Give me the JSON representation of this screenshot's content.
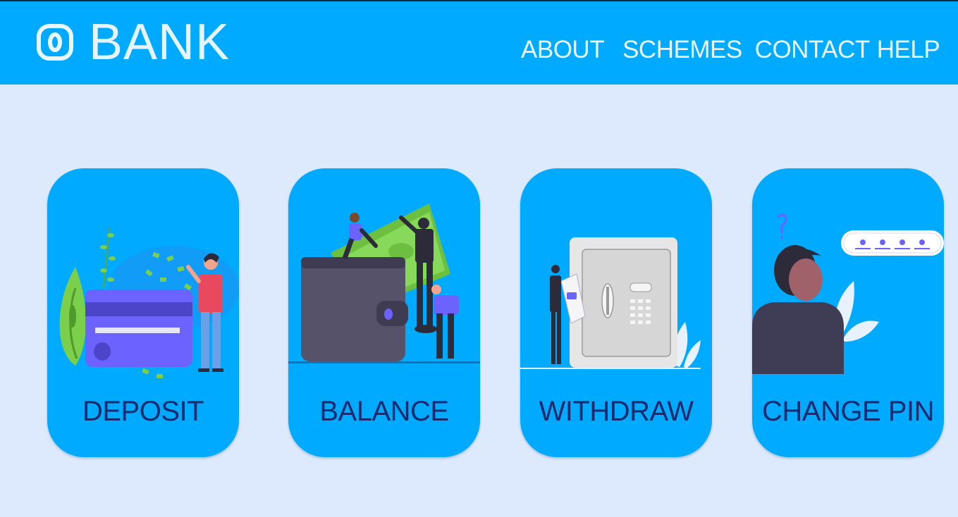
{
  "brand": {
    "name": "BANK",
    "icon": "bank-o-icon"
  },
  "nav": [
    {
      "label": "ABOUT"
    },
    {
      "label": "SCHEMES"
    },
    {
      "label": "CONTACT"
    },
    {
      "label": "HELP"
    }
  ],
  "cards": [
    {
      "label": "DEPOSIT",
      "illustration": "credit-card-deposit-illustration"
    },
    {
      "label": "BALANCE",
      "illustration": "wallet-balance-illustration"
    },
    {
      "label": "WITHDRAW",
      "illustration": "safe-withdraw-illustration"
    },
    {
      "label": "CHANGE PIN",
      "illustration": "pin-code-illustration"
    }
  ],
  "colors": {
    "header": "#00aaff",
    "background": "#ddeafd",
    "card": "#00aaff",
    "card_label": "#1a2a6c"
  }
}
